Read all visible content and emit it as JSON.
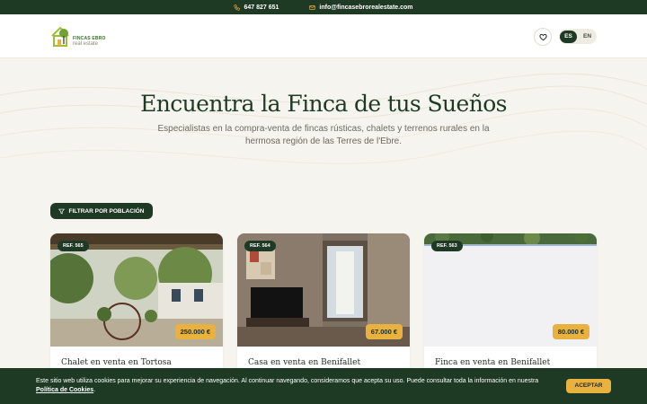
{
  "topbar": {
    "phone": "647 827 651",
    "email": "info@fincasebrorealestate.com",
    "phone_icon": "phone-icon",
    "email_icon": "mail-icon",
    "bg_color": "#1e3a24"
  },
  "header": {
    "logo": {
      "line1": "FINCAS EBRO",
      "line2": "real estate",
      "icon": "house-tree-logo"
    },
    "favorites_icon": "heart-icon",
    "languages": [
      {
        "code": "ES",
        "active": true
      },
      {
        "code": "EN",
        "active": false
      }
    ]
  },
  "hero": {
    "title": "Encuentra la Finca de tus Sueños",
    "subtitle": "Especialistas en la compra-venta de fincas rústicas, chalets y terrenos rurales en la hermosa región de las Terres de l'Ebre."
  },
  "filter": {
    "label": "FILTRAR POR POBLACIÓN",
    "icon": "filter-icon"
  },
  "properties": [
    {
      "ref": "REF. 565",
      "price": "250.000 €",
      "title": "Chalet en venta en Tortosa",
      "photo": "garden-patio-photo"
    },
    {
      "ref": "REF. 564",
      "price": "67.000 €",
      "title": "Casa en venta en Benifallet",
      "photo": "living-room-photo"
    },
    {
      "ref": "REF. 563",
      "price": "80.000 €",
      "title": "Finca en venta en Benifallet",
      "photo": "land-photo"
    }
  ],
  "cookie": {
    "text": "Este sitio web utiliza cookies para mejorar su experiencia de navegación. Al continuar navegando, consideramos que acepta su uso. Puede consultar toda la información en nuestra ",
    "link": "Política de Cookies",
    "end": ".",
    "accept": "ACEPTAR"
  },
  "colors": {
    "primary": "#1e3a24",
    "accent": "#e9b23f",
    "background": "#f6f4ee"
  }
}
